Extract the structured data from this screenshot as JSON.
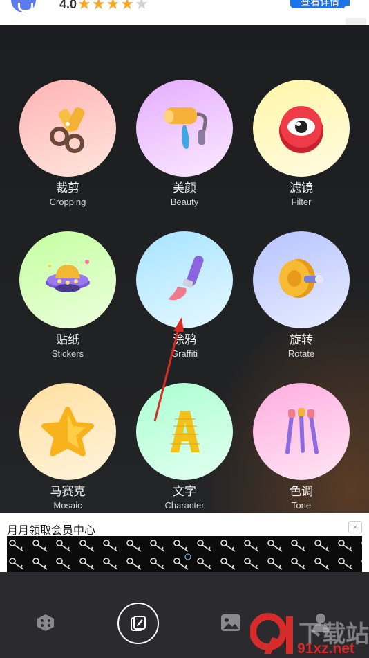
{
  "top_ad": {
    "rating": "4.0",
    "stars_filled": 3.5,
    "stars_total": 5,
    "cta_label": "查看详情"
  },
  "tools": [
    {
      "zh": "裁剪",
      "en": "Cropping",
      "icon": "scissors-icon",
      "bg": [
        "#ffb7b7",
        "#ffe3dc"
      ]
    },
    {
      "zh": "美颜",
      "en": "Beauty",
      "icon": "paint-roller-icon",
      "bg": [
        "#e7b3ff",
        "#fbe7ff"
      ]
    },
    {
      "zh": "滤镜",
      "en": "Filter",
      "icon": "eye-icon",
      "bg": [
        "#fff7b0",
        "#fffbe0"
      ]
    },
    {
      "zh": "贴纸",
      "en": "Stickers",
      "icon": "ufo-icon",
      "bg": [
        "#c8ffa8",
        "#eaffd9"
      ]
    },
    {
      "zh": "涂鸦",
      "en": "Graffiti",
      "icon": "paintbrush-icon",
      "bg": [
        "#a9e6ff",
        "#e5f7ff"
      ]
    },
    {
      "zh": "旋转",
      "en": "Rotate",
      "icon": "spool-icon",
      "bg": [
        "#b9c6ff",
        "#e7ecff"
      ]
    },
    {
      "zh": "马赛克",
      "en": "Mosaic",
      "icon": "star-icon",
      "bg": [
        "#ffe2a6",
        "#fff3dc"
      ]
    },
    {
      "zh": "文字",
      "en": "Character",
      "icon": "letter-a-icon",
      "bg": [
        "#b0ffd2",
        "#e2fff0"
      ]
    },
    {
      "zh": "色调",
      "en": "Tone",
      "icon": "brushes-icon",
      "bg": [
        "#ffb0df",
        "#ffe4f3"
      ]
    }
  ],
  "banner": {
    "title": "月月领取会员中心",
    "close": "×"
  },
  "nav": {
    "items": [
      {
        "icon": "dice-icon"
      },
      {
        "icon": "edit-brush-icon"
      },
      {
        "icon": "image-icon"
      },
      {
        "icon": "person-icon"
      }
    ]
  },
  "watermark": {
    "cn": "下载站",
    "url": "91xz.net"
  }
}
